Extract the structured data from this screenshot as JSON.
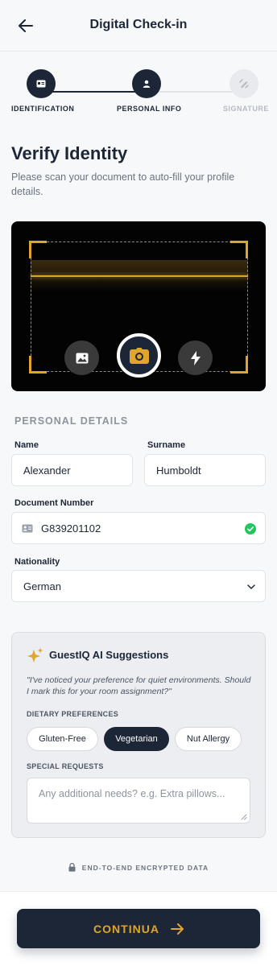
{
  "header": {
    "title": "Digital Check-in",
    "back_icon": "arrow-left-icon"
  },
  "stepper": {
    "steps": [
      {
        "label": "IDENTIFICATION",
        "icon": "id-card-icon",
        "state": "complete"
      },
      {
        "label": "PERSONAL INFO",
        "icon": "user-icon",
        "state": "current"
      },
      {
        "label": "SIGNATURE",
        "icon": "signature-icon",
        "state": "upcoming"
      }
    ]
  },
  "main": {
    "title": "Verify Identity",
    "subtitle": "Please scan your document to auto-fill your profile details."
  },
  "scanner": {
    "buttons": [
      "image-icon",
      "camera-icon",
      "flash-icon"
    ],
    "accent_color": "#e0a62c"
  },
  "personal_details": {
    "section_label": "PERSONAL DETAILS",
    "name": {
      "label": "Name",
      "value": "Alexander"
    },
    "surname": {
      "label": "Surname",
      "value": "Humboldt"
    },
    "document_number": {
      "label": "Document Number",
      "value": "G839201102",
      "verified": true
    },
    "nationality": {
      "label": "Nationality",
      "value": "German"
    }
  },
  "ai_suggestions": {
    "title": "GuestIQ AI Suggestions",
    "quote": "\"I've noticed your preference for quiet environments. Should I mark this for your room assignment?\"",
    "dietary_label": "DIETARY PREFERENCES",
    "dietary_options": [
      {
        "label": "Gluten-Free",
        "selected": false
      },
      {
        "label": "Vegetarian",
        "selected": true
      },
      {
        "label": "Nut Allergy",
        "selected": false
      }
    ],
    "special_requests_label": "SPECIAL REQUESTS",
    "special_requests_placeholder": "Any additional needs? e.g. Extra pillows..."
  },
  "security": {
    "text": "END-TO-END ENCRYPTED DATA"
  },
  "footer": {
    "continue_label": "CONTINUA"
  },
  "colors": {
    "primary": "#1c2636",
    "accent": "#e0a62c",
    "success": "#22c55e"
  }
}
